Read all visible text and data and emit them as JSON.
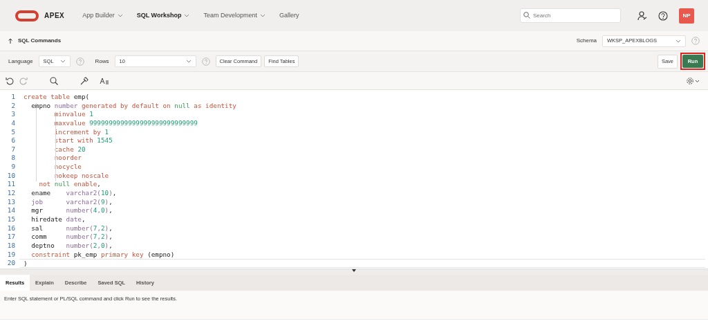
{
  "header": {
    "logo": "APEX",
    "nav": [
      {
        "label": "App Builder",
        "dropdown": true,
        "selected": false
      },
      {
        "label": "SQL Workshop",
        "dropdown": true,
        "selected": true
      },
      {
        "label": "Team Development",
        "dropdown": true,
        "selected": false
      },
      {
        "label": "Gallery",
        "dropdown": false,
        "selected": false
      }
    ],
    "search": {
      "placeholder": "Search"
    },
    "avatar": "NP"
  },
  "breadcrumb": {
    "title": "SQL Commands"
  },
  "schema": {
    "label": "Schema",
    "value": "WKSP_APEXBLOGS"
  },
  "toolbar": {
    "language_label": "Language",
    "language": "SQL",
    "rows_label": "Rows",
    "rows": "10",
    "buttons": [
      "Clear Command",
      "Find Tables"
    ],
    "save": "Save",
    "run": "Run",
    "run_highlighted": true
  },
  "editor": {
    "lines": [
      {
        "number": "1",
        "active": false,
        "tokens": [
          {
            "kind": "keyword",
            "text": "create table "
          },
          {
            "kind": "plain",
            "text": "emp("
          }
        ]
      },
      {
        "number": "2",
        "active": false,
        "tokens": [
          {
            "kind": "plain",
            "text": "  empno "
          },
          {
            "kind": "type",
            "text": "number "
          },
          {
            "kind": "keyword",
            "text": "generated by default on "
          },
          {
            "kind": "literal",
            "text": "null"
          },
          {
            "kind": "keyword",
            "text": " as identity"
          }
        ]
      },
      {
        "number": "3",
        "active": false,
        "tokens": [
          {
            "kind": "keyword",
            "text": "        minvalue "
          },
          {
            "kind": "number",
            "text": "1"
          }
        ]
      },
      {
        "number": "4",
        "active": false,
        "tokens": [
          {
            "kind": "keyword",
            "text": "        maxvalue "
          },
          {
            "kind": "number",
            "text": "9999999999999999999999999999"
          }
        ]
      },
      {
        "number": "5",
        "active": false,
        "tokens": [
          {
            "kind": "keyword",
            "text": "        increment by "
          },
          {
            "kind": "number",
            "text": "1"
          }
        ]
      },
      {
        "number": "6",
        "active": false,
        "tokens": [
          {
            "kind": "keyword",
            "text": "        start with "
          },
          {
            "kind": "number",
            "text": "1545"
          }
        ]
      },
      {
        "number": "7",
        "active": false,
        "tokens": [
          {
            "kind": "keyword",
            "text": "        cache "
          },
          {
            "kind": "number",
            "text": "20"
          }
        ]
      },
      {
        "number": "8",
        "active": false,
        "tokens": [
          {
            "kind": "keyword",
            "text": "        noorder"
          }
        ]
      },
      {
        "number": "9",
        "active": false,
        "tokens": [
          {
            "kind": "keyword",
            "text": "        nocycle"
          }
        ]
      },
      {
        "number": "10",
        "active": false,
        "tokens": [
          {
            "kind": "keyword",
            "text": "        nokeep noscale"
          }
        ]
      },
      {
        "number": "11",
        "active": false,
        "tokens": [
          {
            "kind": "keyword",
            "text": "    not "
          },
          {
            "kind": "literal",
            "text": "null"
          },
          {
            "kind": "keyword",
            "text": " enable"
          },
          {
            "kind": "plain",
            "text": ","
          }
        ]
      },
      {
        "number": "12",
        "active": false,
        "tokens": [
          {
            "kind": "plain",
            "text": "  ename    "
          },
          {
            "kind": "type",
            "text": "varchar2("
          },
          {
            "kind": "number",
            "text": "10"
          },
          {
            "kind": "type",
            "text": ")"
          },
          {
            "kind": "plain",
            "text": ","
          }
        ]
      },
      {
        "number": "13",
        "active": false,
        "tokens": [
          {
            "kind": "type",
            "text": "  job      varchar2("
          },
          {
            "kind": "number",
            "text": "9"
          },
          {
            "kind": "type",
            "text": ")"
          },
          {
            "kind": "plain",
            "text": ","
          }
        ]
      },
      {
        "number": "14",
        "active": false,
        "tokens": [
          {
            "kind": "plain",
            "text": "  mgr      "
          },
          {
            "kind": "type",
            "text": "number("
          },
          {
            "kind": "number",
            "text": "4"
          },
          {
            "kind": "type",
            "text": ","
          },
          {
            "kind": "number",
            "text": "0"
          },
          {
            "kind": "type",
            "text": ")"
          },
          {
            "kind": "plain",
            "text": ","
          }
        ]
      },
      {
        "number": "15",
        "active": false,
        "tokens": [
          {
            "kind": "plain",
            "text": "  hiredate "
          },
          {
            "kind": "type",
            "text": "date"
          },
          {
            "kind": "plain",
            "text": ","
          }
        ]
      },
      {
        "number": "16",
        "active": false,
        "tokens": [
          {
            "kind": "plain",
            "text": "  sal      "
          },
          {
            "kind": "type",
            "text": "number("
          },
          {
            "kind": "number",
            "text": "7"
          },
          {
            "kind": "type",
            "text": ","
          },
          {
            "kind": "number",
            "text": "2"
          },
          {
            "kind": "type",
            "text": ")"
          },
          {
            "kind": "plain",
            "text": ","
          }
        ]
      },
      {
        "number": "17",
        "active": false,
        "tokens": [
          {
            "kind": "plain",
            "text": "  comm     "
          },
          {
            "kind": "type",
            "text": "number("
          },
          {
            "kind": "number",
            "text": "7"
          },
          {
            "kind": "type",
            "text": ","
          },
          {
            "kind": "number",
            "text": "2"
          },
          {
            "kind": "type",
            "text": ")"
          },
          {
            "kind": "plain",
            "text": ","
          }
        ]
      },
      {
        "number": "18",
        "active": false,
        "tokens": [
          {
            "kind": "plain",
            "text": "  deptno   "
          },
          {
            "kind": "type",
            "text": "number("
          },
          {
            "kind": "number",
            "text": "2"
          },
          {
            "kind": "type",
            "text": ","
          },
          {
            "kind": "number",
            "text": "0"
          },
          {
            "kind": "type",
            "text": ")"
          },
          {
            "kind": "plain",
            "text": ","
          }
        ]
      },
      {
        "number": "19",
        "active": false,
        "tokens": [
          {
            "kind": "keyword",
            "text": "  constraint "
          },
          {
            "kind": "plain",
            "text": "pk_emp "
          },
          {
            "kind": "keyword",
            "text": "primary key "
          },
          {
            "kind": "plain",
            "text": "(empno)"
          }
        ]
      },
      {
        "number": "20",
        "active": true,
        "tokens": [
          {
            "kind": "plain",
            "text": ")"
          }
        ]
      }
    ]
  },
  "results": {
    "tabs": [
      {
        "label": "Results",
        "selected": true
      },
      {
        "label": "Explain",
        "selected": false
      },
      {
        "label": "Describe",
        "selected": false
      },
      {
        "label": "Saved SQL",
        "selected": false
      },
      {
        "label": "History",
        "selected": false
      }
    ],
    "message": "Enter SQL statement or PL/SQL command and click Run to see the results."
  }
}
